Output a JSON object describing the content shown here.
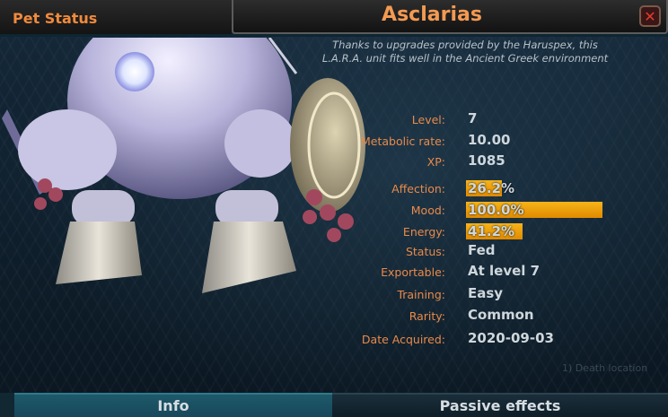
{
  "header": {
    "section_label": "Pet Status",
    "pet_name": "Asclarias",
    "close_label": "✕"
  },
  "description": "Thanks to upgrades provided by the Haruspex, this L.A.R.A. unit fits well in the Ancient Greek environment",
  "stats": {
    "level": {
      "label": "Level:",
      "value": "7"
    },
    "metabolic_rate": {
      "label": "Metabolic rate:",
      "value": "10.00"
    },
    "xp": {
      "label": "XP:",
      "value": "1085"
    },
    "affection": {
      "label": "Affection:",
      "value": "26.2%",
      "fraction": 0.262
    },
    "mood": {
      "label": "Mood:",
      "value": "100.0%",
      "fraction": 1.0
    },
    "energy": {
      "label": "Energy:",
      "value": "41.2%",
      "fraction": 0.412
    },
    "status": {
      "label": "Status:",
      "value": "Fed"
    },
    "exportable": {
      "label": "Exportable:",
      "value": "At level 7"
    },
    "training": {
      "label": "Training:",
      "value": "Easy"
    },
    "rarity": {
      "label": "Rarity:",
      "value": "Common"
    },
    "date_acquired": {
      "label": "Date Acquired:",
      "value": "2020-09-03"
    }
  },
  "tabs": {
    "info": "Info",
    "passive_effects": "Passive effects"
  },
  "background_text": {
    "death_location": "1) Death location"
  },
  "colors": {
    "accent_orange": "#f39a52",
    "bar_fill": "#f6b41a",
    "close_red": "#e23b2f"
  }
}
